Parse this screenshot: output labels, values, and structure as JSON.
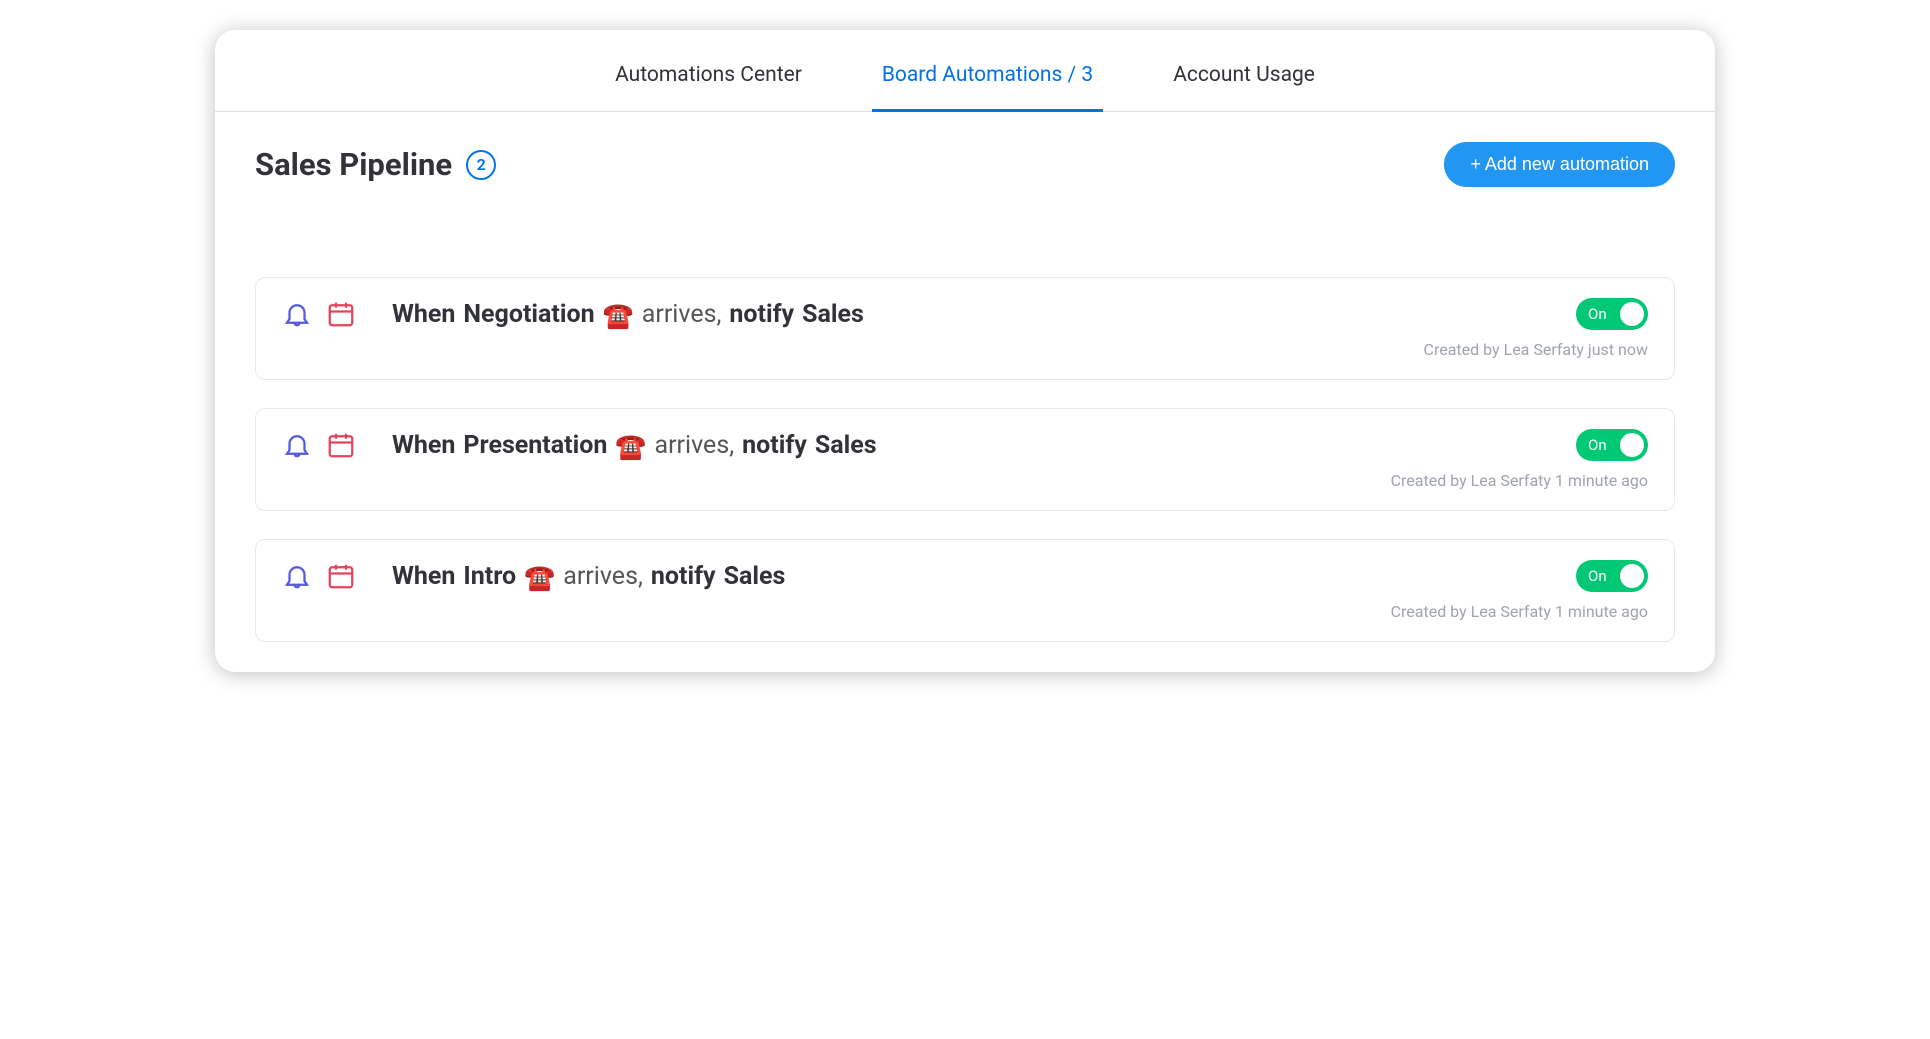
{
  "tabs": [
    {
      "label": "Automations Center",
      "active": false
    },
    {
      "label": "Board Automations / 3",
      "active": true
    },
    {
      "label": "Account Usage",
      "active": false
    }
  ],
  "header": {
    "title": "Sales Pipeline",
    "count": "2",
    "add_label": "+ Add new automation"
  },
  "icons": {
    "bell": "bell-icon",
    "calendar": "calendar-icon",
    "phone_emoji": "☎️"
  },
  "toggle": {
    "on_label": "On"
  },
  "automations": [
    {
      "when": "When",
      "stage": "Negotiation",
      "arrives": "arrives,",
      "notify": "notify",
      "target": "Sales",
      "meta": "Created by Lea Serfaty just now",
      "enabled": true
    },
    {
      "when": "When",
      "stage": "Presentation",
      "arrives": "arrives,",
      "notify": "notify",
      "target": "Sales",
      "meta": "Created by Lea Serfaty 1 minute ago",
      "enabled": true
    },
    {
      "when": "When",
      "stage": "Intro",
      "arrives": "arrives,",
      "notify": "notify",
      "target": "Sales",
      "meta": "Created by Lea Serfaty 1 minute ago",
      "enabled": true
    }
  ]
}
